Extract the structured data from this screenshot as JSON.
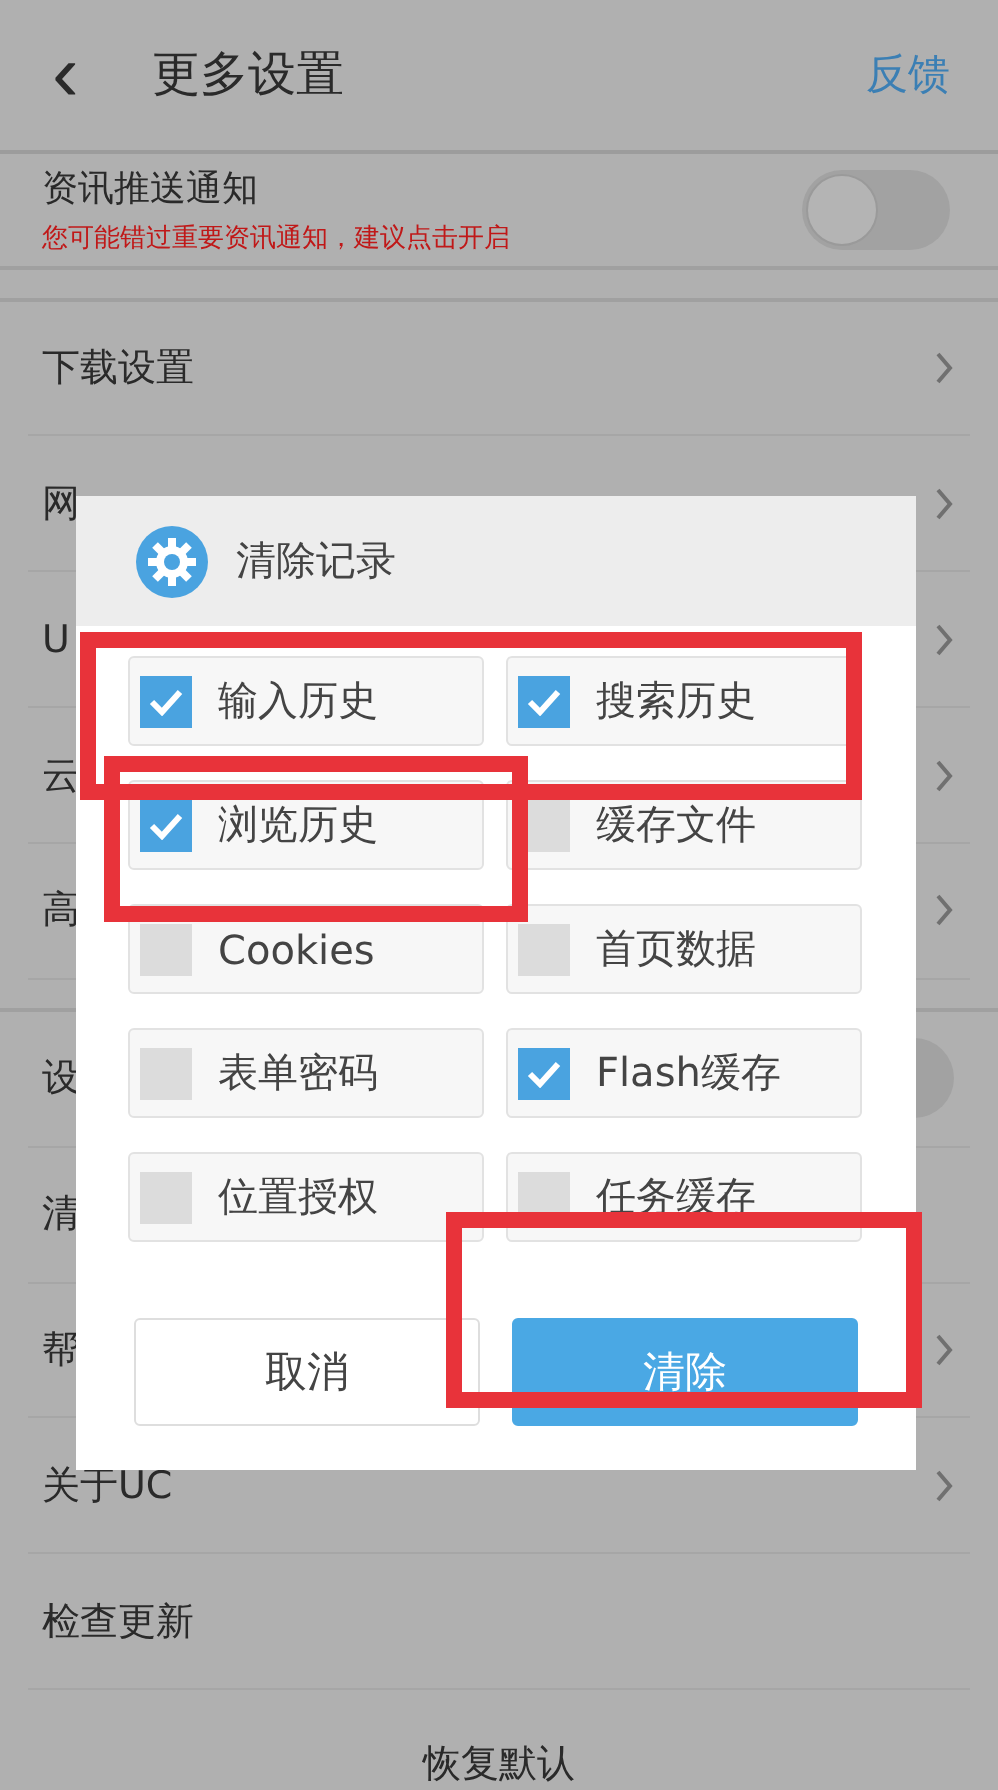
{
  "header": {
    "back": "‹",
    "title": "更多设置",
    "action": "反馈"
  },
  "notification": {
    "title": "资讯推送通知",
    "hint": "您可能错过重要资讯通知，建议点击开启",
    "on": false
  },
  "sections": [
    {
      "items": [
        {
          "label": "下载设置",
          "kind": "link"
        },
        {
          "label": "网",
          "kind": "link"
        },
        {
          "label": "U",
          "kind": "link"
        },
        {
          "label": "云",
          "kind": "link"
        },
        {
          "label": "高",
          "kind": "link"
        }
      ]
    },
    {
      "items": [
        {
          "label": "设",
          "kind": "toggle",
          "on": false
        },
        {
          "label": "清",
          "kind": "plain"
        },
        {
          "label": "帮",
          "kind": "link"
        },
        {
          "label": "关于UC",
          "kind": "link"
        },
        {
          "label": "检查更新",
          "kind": "plain"
        }
      ]
    }
  ],
  "reset": "恢复默认",
  "dialog": {
    "title": "清除记录",
    "options": [
      {
        "label": "输入历史",
        "checked": true
      },
      {
        "label": "搜索历史",
        "checked": true
      },
      {
        "label": "浏览历史",
        "checked": true
      },
      {
        "label": "缓存文件",
        "checked": false
      },
      {
        "label": "Cookies",
        "checked": false
      },
      {
        "label": "首页数据",
        "checked": false
      },
      {
        "label": "表单密码",
        "checked": false
      },
      {
        "label": "Flash缓存",
        "checked": true
      },
      {
        "label": "位置授权",
        "checked": false
      },
      {
        "label": "任务缓存",
        "checked": false
      }
    ],
    "buttons": [
      {
        "label": "取消",
        "kind": "secondary"
      },
      {
        "label": "清除",
        "kind": "primary"
      }
    ]
  },
  "annotation_frames": [
    {
      "kind": "frame"
    },
    {
      "kind": "frame"
    },
    {
      "kind": "frame"
    }
  ]
}
